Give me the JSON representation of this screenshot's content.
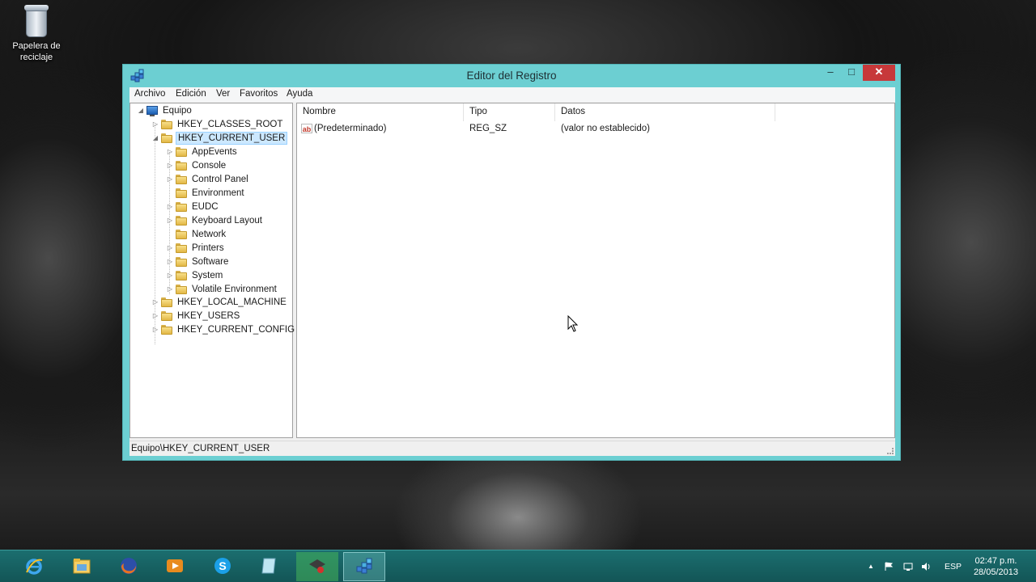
{
  "desktop": {
    "icons": [
      {
        "label_line1": "Papelera de",
        "label_line2": "reciclaje"
      }
    ]
  },
  "window": {
    "title": "Editor del Registro",
    "controls": {
      "minimize": "–",
      "maximize": "□",
      "close": "✕"
    },
    "menu": [
      "Archivo",
      "Edición",
      "Ver",
      "Favoritos",
      "Ayuda"
    ],
    "tree": {
      "root": "Equipo",
      "nodes": [
        "HKEY_CLASSES_ROOT",
        "HKEY_CURRENT_USER",
        "AppEvents",
        "Console",
        "Control Panel",
        "Environment",
        "EUDC",
        "Keyboard Layout",
        "Network",
        "Printers",
        "Software",
        "System",
        "Volatile Environment",
        "HKEY_LOCAL_MACHINE",
        "HKEY_USERS",
        "HKEY_CURRENT_CONFIG"
      ],
      "selected": "HKEY_CURRENT_USER"
    },
    "list": {
      "columns": [
        "Nombre",
        "Tipo",
        "Datos"
      ],
      "rows": [
        {
          "name": "(Predeterminado)",
          "type": "REG_SZ",
          "data": "(valor no establecido)",
          "icon": "ab-string-icon"
        }
      ]
    },
    "status": "Equipo\\HKEY_CURRENT_USER"
  },
  "taskbar": {
    "apps": [
      {
        "name": "internet-explorer-icon",
        "active": false
      },
      {
        "name": "file-explorer-icon",
        "active": false
      },
      {
        "name": "firefox-icon",
        "active": false
      },
      {
        "name": "media-player-icon",
        "active": false
      },
      {
        "name": "skype-icon",
        "active": false
      },
      {
        "name": "notepad-icon",
        "active": false
      },
      {
        "name": "recorder-icon",
        "active": false
      },
      {
        "name": "regedit-icon",
        "active": true
      }
    ],
    "language": "ESP",
    "time": "02:47 p.m.",
    "date": "28/05/2013"
  },
  "colors": {
    "window_frame": "#6ccfd2",
    "close_button": "#c7383a",
    "taskbar": "#1b6e6f",
    "selection": "#cce8ff"
  }
}
